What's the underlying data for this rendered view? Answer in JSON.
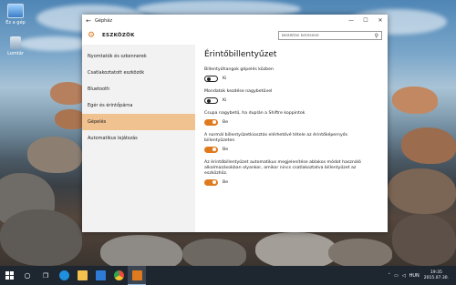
{
  "desktop": {
    "icons": [
      {
        "label": "Ez a gép",
        "icon": "computer-icon"
      },
      {
        "label": "Lomtár",
        "icon": "recycle-bin-icon"
      }
    ]
  },
  "window": {
    "title": "Gépház",
    "back_icon": "back-arrow-icon",
    "controls": {
      "minimize": "—",
      "maximize": "☐",
      "close": "✕"
    },
    "section_title": "ESZKÖZÖK",
    "section_icon": "gear-icon",
    "search_placeholder": "Beállítás keresése",
    "search_icon": "search-icon",
    "nav": {
      "items": [
        {
          "label": "Nyomtatók és szkennerek"
        },
        {
          "label": "Csatlakoztatott eszközök"
        },
        {
          "label": "Bluetooth"
        },
        {
          "label": "Egér és érintőpárna"
        },
        {
          "label": "Gépelés",
          "active": true
        },
        {
          "label": "Automatikus lejátszás"
        }
      ]
    },
    "content": {
      "heading": "Érintőbillentyűzet",
      "settings": [
        {
          "label": "Billentyűhangok gépelés közben",
          "state": "Ki",
          "on": false
        },
        {
          "label": "Mondatok kezdése nagybetűvel",
          "state": "Ki",
          "on": false
        },
        {
          "label": "Csupa nagybetű, ha duplán a Shiftre koppintok",
          "state": "Be",
          "on": true
        },
        {
          "label": "A normál billentyűzetkiosztás elérhetővé tétele az érintőképernyős billentyűzeten",
          "state": "Be",
          "on": true
        },
        {
          "label": "Az érintőbillentyűzet automatikus megjelenítése ablakos módot használó alkalmazásokban olyankor, amikor nincs csatlakoztatva billentyűzet az eszközhöz.",
          "state": "Be",
          "on": true
        }
      ]
    }
  },
  "taskbar": {
    "start_icon": "windows-start-icon",
    "search_icon": "search-icon",
    "taskview_icon": "task-view-icon",
    "apps": [
      {
        "icon": "edge-browser-icon",
        "color": "#1f8fe0"
      },
      {
        "icon": "file-explorer-icon",
        "color": "#f2c14e"
      },
      {
        "icon": "store-icon",
        "color": "#2e7bd6"
      },
      {
        "icon": "chrome-icon",
        "color": "#e94b3c"
      },
      {
        "icon": "settings-icon",
        "color": "#e07a1f"
      }
    ],
    "tray": {
      "language": "HUN",
      "time": "19:35",
      "date": "2015.07.30."
    }
  },
  "colors": {
    "accent": "#e07a1f",
    "nav_active": "#f0c28f",
    "taskbar": "#1e2630"
  }
}
